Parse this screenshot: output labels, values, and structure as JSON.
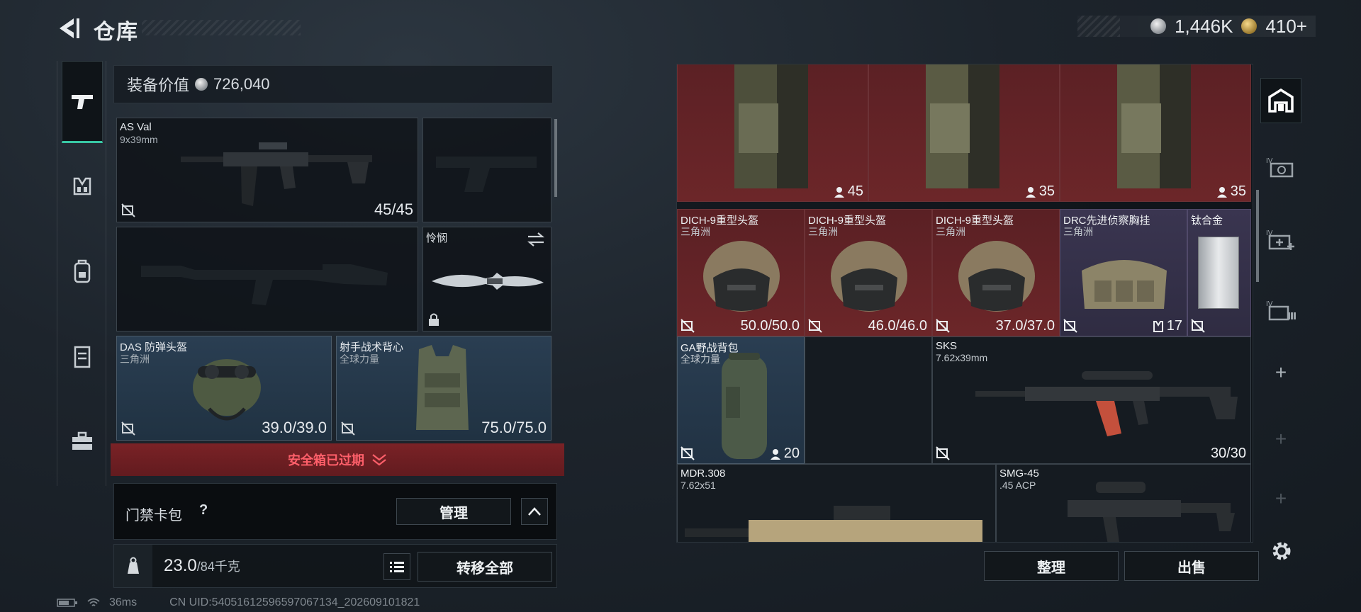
{
  "header": {
    "title": "仓库",
    "silver_amount": "1,446K",
    "gold_amount": "410+"
  },
  "left_panel": {
    "value_label": "装备价值",
    "value_amount": "726,040",
    "slots": {
      "primary": {
        "name": "AS Val",
        "sub": "9x39mm",
        "count": "45/45"
      },
      "melee": {
        "name": "怜悯"
      },
      "helmet": {
        "name": "DAS 防弹头盔",
        "sub": "三角洲",
        "durability": "39.0/39.0"
      },
      "vest": {
        "name": "射手战术背心",
        "sub": "全球力量",
        "durability": "75.0/75.0"
      }
    },
    "safe_box_expired": "安全箱已过期",
    "keycard_label": "门禁卡包",
    "keycard_help": "?",
    "manage_button": "管理",
    "weight_value": "23.0",
    "weight_max": "/84千克",
    "transfer_all_button": "转移全部"
  },
  "grid": {
    "top_row": [
      {
        "count": "45"
      },
      {
        "count": "35"
      },
      {
        "count": "35"
      }
    ],
    "row2": [
      {
        "name": "DICH-9重型头盔",
        "sub": "三角洲",
        "durability": "50.0/50.0"
      },
      {
        "name": "DICH-9重型头盔",
        "sub": "三角洲",
        "durability": "46.0/46.0"
      },
      {
        "name": "DICH-9重型头盔",
        "sub": "三角洲",
        "durability": "37.0/37.0"
      },
      {
        "name": "DRC先进侦察胸挂",
        "sub": "三角洲",
        "count": "17"
      },
      {
        "name": "钛合金"
      }
    ],
    "row3": [
      {
        "name": "GA野战背包",
        "sub": "全球力量",
        "count": "20"
      },
      {
        "name": "SKS",
        "sub": "7.62x39mm",
        "count": "30/30"
      }
    ],
    "row4": [
      {
        "name": "MDR.308",
        "sub": "7.62x51"
      },
      {
        "name": "SMG-45",
        "sub": ".45 ACP"
      }
    ]
  },
  "bottom_buttons": {
    "sort": "整理",
    "sell": "出售"
  },
  "status": {
    "ping": "36ms",
    "uid": "CN UID:5405161259659706713​4_202609101821"
  },
  "colors": {
    "accent": "#38c7a4",
    "expired_bg": "#6c1e22",
    "expired_text": "#ff5f6a",
    "red_cell": "#5f2327",
    "blue_cell": "#263a4d"
  }
}
